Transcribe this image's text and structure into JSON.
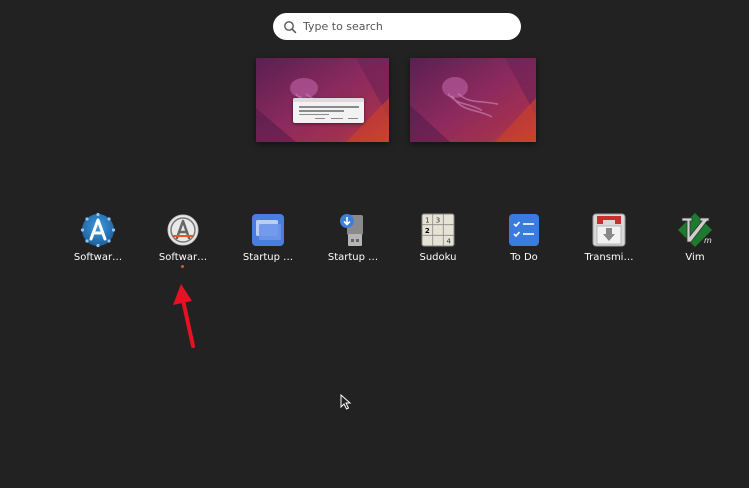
{
  "search": {
    "placeholder": "Type to search",
    "value": ""
  },
  "apps": [
    {
      "name": "Softwar…",
      "icon": "software-updater-icon"
    },
    {
      "name": "Softwar…",
      "icon": "software-store-icon",
      "running": true
    },
    {
      "name": "Startup …",
      "icon": "startup-applications-icon"
    },
    {
      "name": "Startup …",
      "icon": "startup-disk-creator-icon"
    },
    {
      "name": "Sudoku",
      "icon": "sudoku-icon"
    },
    {
      "name": "To Do",
      "icon": "todo-icon"
    },
    {
      "name": "Transmi…",
      "icon": "transmission-icon"
    },
    {
      "name": "Vim",
      "icon": "vim-icon"
    }
  ],
  "sudoku_digits": [
    "1",
    "3",
    "2",
    "4"
  ],
  "colors": {
    "accent": "#e95420",
    "background": "#222222",
    "annotation_arrow": "#e81123"
  }
}
